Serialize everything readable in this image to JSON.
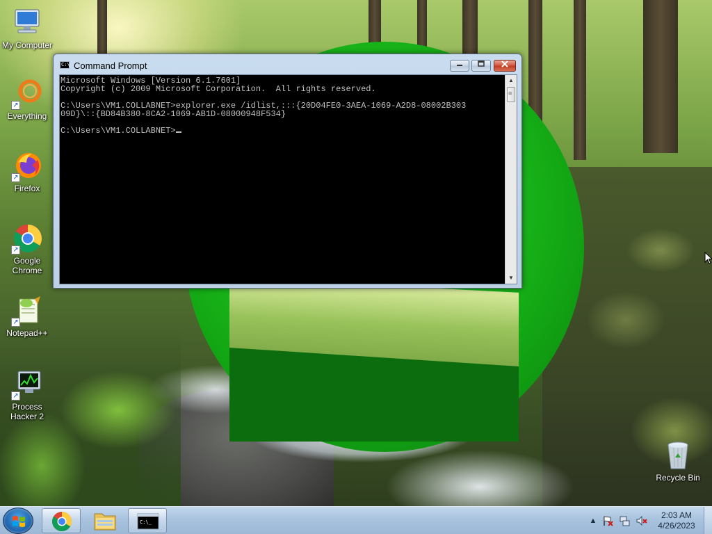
{
  "desktop": {
    "icons": [
      {
        "label": "My Computer"
      },
      {
        "label": "Everything"
      },
      {
        "label": "Firefox"
      },
      {
        "label": "Google Chrome"
      },
      {
        "label": "Notepad++"
      },
      {
        "label": "Process Hacker 2"
      },
      {
        "label": "Recycle Bin"
      }
    ]
  },
  "cmd_window": {
    "title": "Command Prompt",
    "lines": [
      "Microsoft Windows [Version 6.1.7601]",
      "Copyright (c) 2009 Microsoft Corporation.  All rights reserved.",
      "",
      "C:\\Users\\VM1.COLLABNET>explorer.exe /idlist,:::{20D04FE0-3AEA-1069-A2D8-08002B303",
      "09D}\\::{BD84B380-8CA2-1069-AB1D-08000948F534}",
      "",
      "C:\\Users\\VM1.COLLABNET>"
    ],
    "buttons": {
      "minimize": "minimize",
      "maximize": "maximize",
      "close": "close"
    }
  },
  "taskbar": {
    "start": "start-button",
    "pinned": [
      "chrome-icon",
      "windows-explorer-icon",
      "command-prompt-icon"
    ],
    "tray": {
      "icons": [
        "show-hidden-icons-arrow",
        "action-center-flag-icon",
        "network-icon",
        "volume-muted-icon"
      ],
      "time": "2:03 AM",
      "date": "4/26/2023"
    }
  },
  "colors": {
    "console_bg": "#000000",
    "console_fg": "#c0c0c0",
    "taskbar": "#a9c3de",
    "logo_green": "#13a814"
  }
}
